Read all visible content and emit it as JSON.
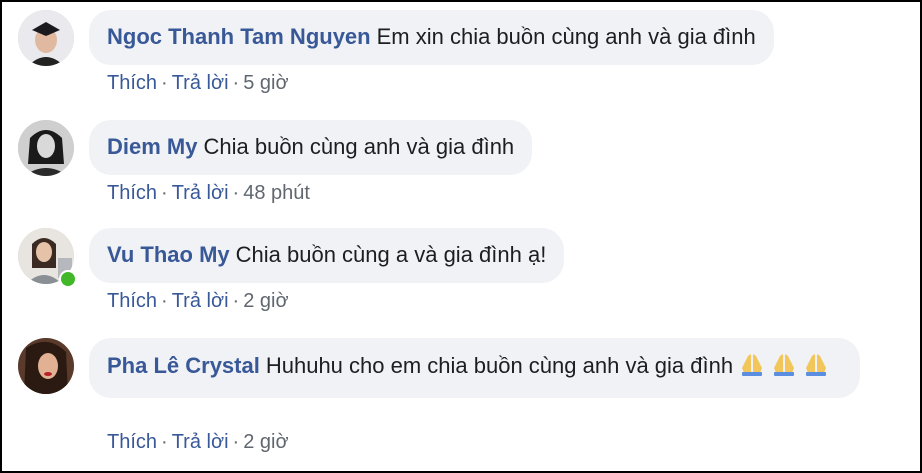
{
  "comments": [
    {
      "author": "Ngoc Thanh Tam Nguyen",
      "text": "Em xin chia buồn cùng anh và gia đình",
      "like_label": "Thích",
      "reply_label": "Trả lời",
      "separator": "·",
      "time": "5 giờ",
      "avatar_icon": "profile-photo-graduation",
      "online": false
    },
    {
      "author": "Diem My",
      "text": "Chia buồn cùng anh và gia đình",
      "like_label": "Thích",
      "reply_label": "Trả lời",
      "separator": "·",
      "time": "48 phút",
      "avatar_icon": "profile-photo-bw",
      "online": false
    },
    {
      "author": "Vu Thao My",
      "text": "Chia buồn cùng a và gia đình ạ!",
      "like_label": "Thích",
      "reply_label": "Trả lời",
      "separator": "·",
      "time": "2 giờ",
      "avatar_icon": "profile-photo-light",
      "online": true
    },
    {
      "author": "Pha Lê Crystal",
      "text": "Huhuhu cho em chia buồn cùng anh và gia đình",
      "emoji": "folded-hands-icon",
      "like_label": "Thích",
      "reply_label": "Trả lời",
      "separator": "·",
      "time": "2 giờ",
      "avatar_icon": "profile-photo-dark",
      "online": false
    }
  ],
  "colors": {
    "author": "#385898",
    "meta": "#606770",
    "bubble_bg": "#f0f2f5",
    "online": "#42b72a"
  }
}
